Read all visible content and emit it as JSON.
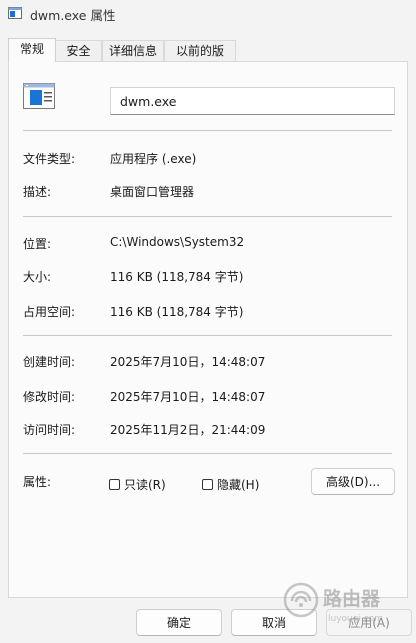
{
  "window": {
    "title": "dwm.exe 属性"
  },
  "tabs": [
    {
      "label": "常规",
      "active": true
    },
    {
      "label": "安全"
    },
    {
      "label": "详细信息"
    },
    {
      "label": "以前的版本"
    }
  ],
  "general": {
    "filename": "dwm.exe",
    "file_type_label": "文件类型:",
    "file_type_value": "应用程序 (.exe)",
    "description_label": "描述:",
    "description_value": "桌面窗口管理器",
    "location_label": "位置:",
    "location_value": "C:\\Windows\\System32",
    "size_label": "大小:",
    "size_value": "116 KB (118,784 字节)",
    "size_on_disk_label": "占用空间:",
    "size_on_disk_value": "116 KB (118,784 字节)",
    "created_label": "创建时间:",
    "created_value": "2025年7月10日，14:48:07",
    "modified_label": "修改时间:",
    "modified_value": "2025年7月10日，14:48:07",
    "accessed_label": "访问时间:",
    "accessed_value": "2025年11月2日，21:44:09",
    "attributes_label": "属性:",
    "readonly_label": "只读(R)",
    "readonly_checked": false,
    "hidden_label": "隐藏(H)",
    "hidden_checked": false,
    "advanced_button": "高级(D)..."
  },
  "footer": {
    "ok": "确定",
    "cancel": "取消",
    "apply": "应用(A)"
  },
  "watermark": {
    "text": "路由器",
    "subtext": "luyouqi.com"
  }
}
